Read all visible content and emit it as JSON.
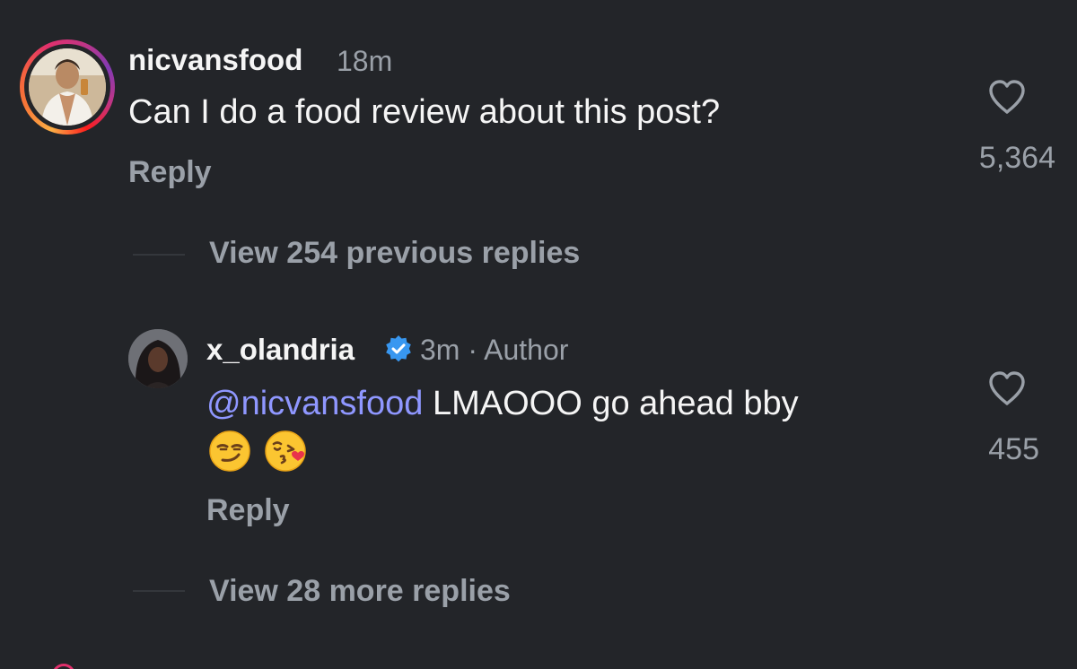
{
  "comments": [
    {
      "username": "nicvansfood",
      "time": "18m",
      "text": "Can I do a food review about this post?",
      "reply_label": "Reply",
      "likes": "5,364",
      "has_story_ring": true,
      "icon": "heart-outline-icon"
    },
    {
      "username": "x_olandria",
      "verified": true,
      "time_author": "3m · Author",
      "mention": "@nicvansfood",
      "text": " LMAOOO go ahead bby",
      "emojis": [
        "smirking-face",
        "face-blowing-kiss"
      ],
      "reply_label": "Reply",
      "likes": "455",
      "icon": "heart-outline-icon"
    }
  ],
  "threads": {
    "view_previous": "View 254 previous replies",
    "view_more": "View 28 more replies"
  },
  "colors": {
    "background": "#232529",
    "primary_text": "#f5f5f5",
    "secondary_text": "#9aa0a8",
    "mention": "#8f97ff",
    "verified": "#3897f0"
  }
}
